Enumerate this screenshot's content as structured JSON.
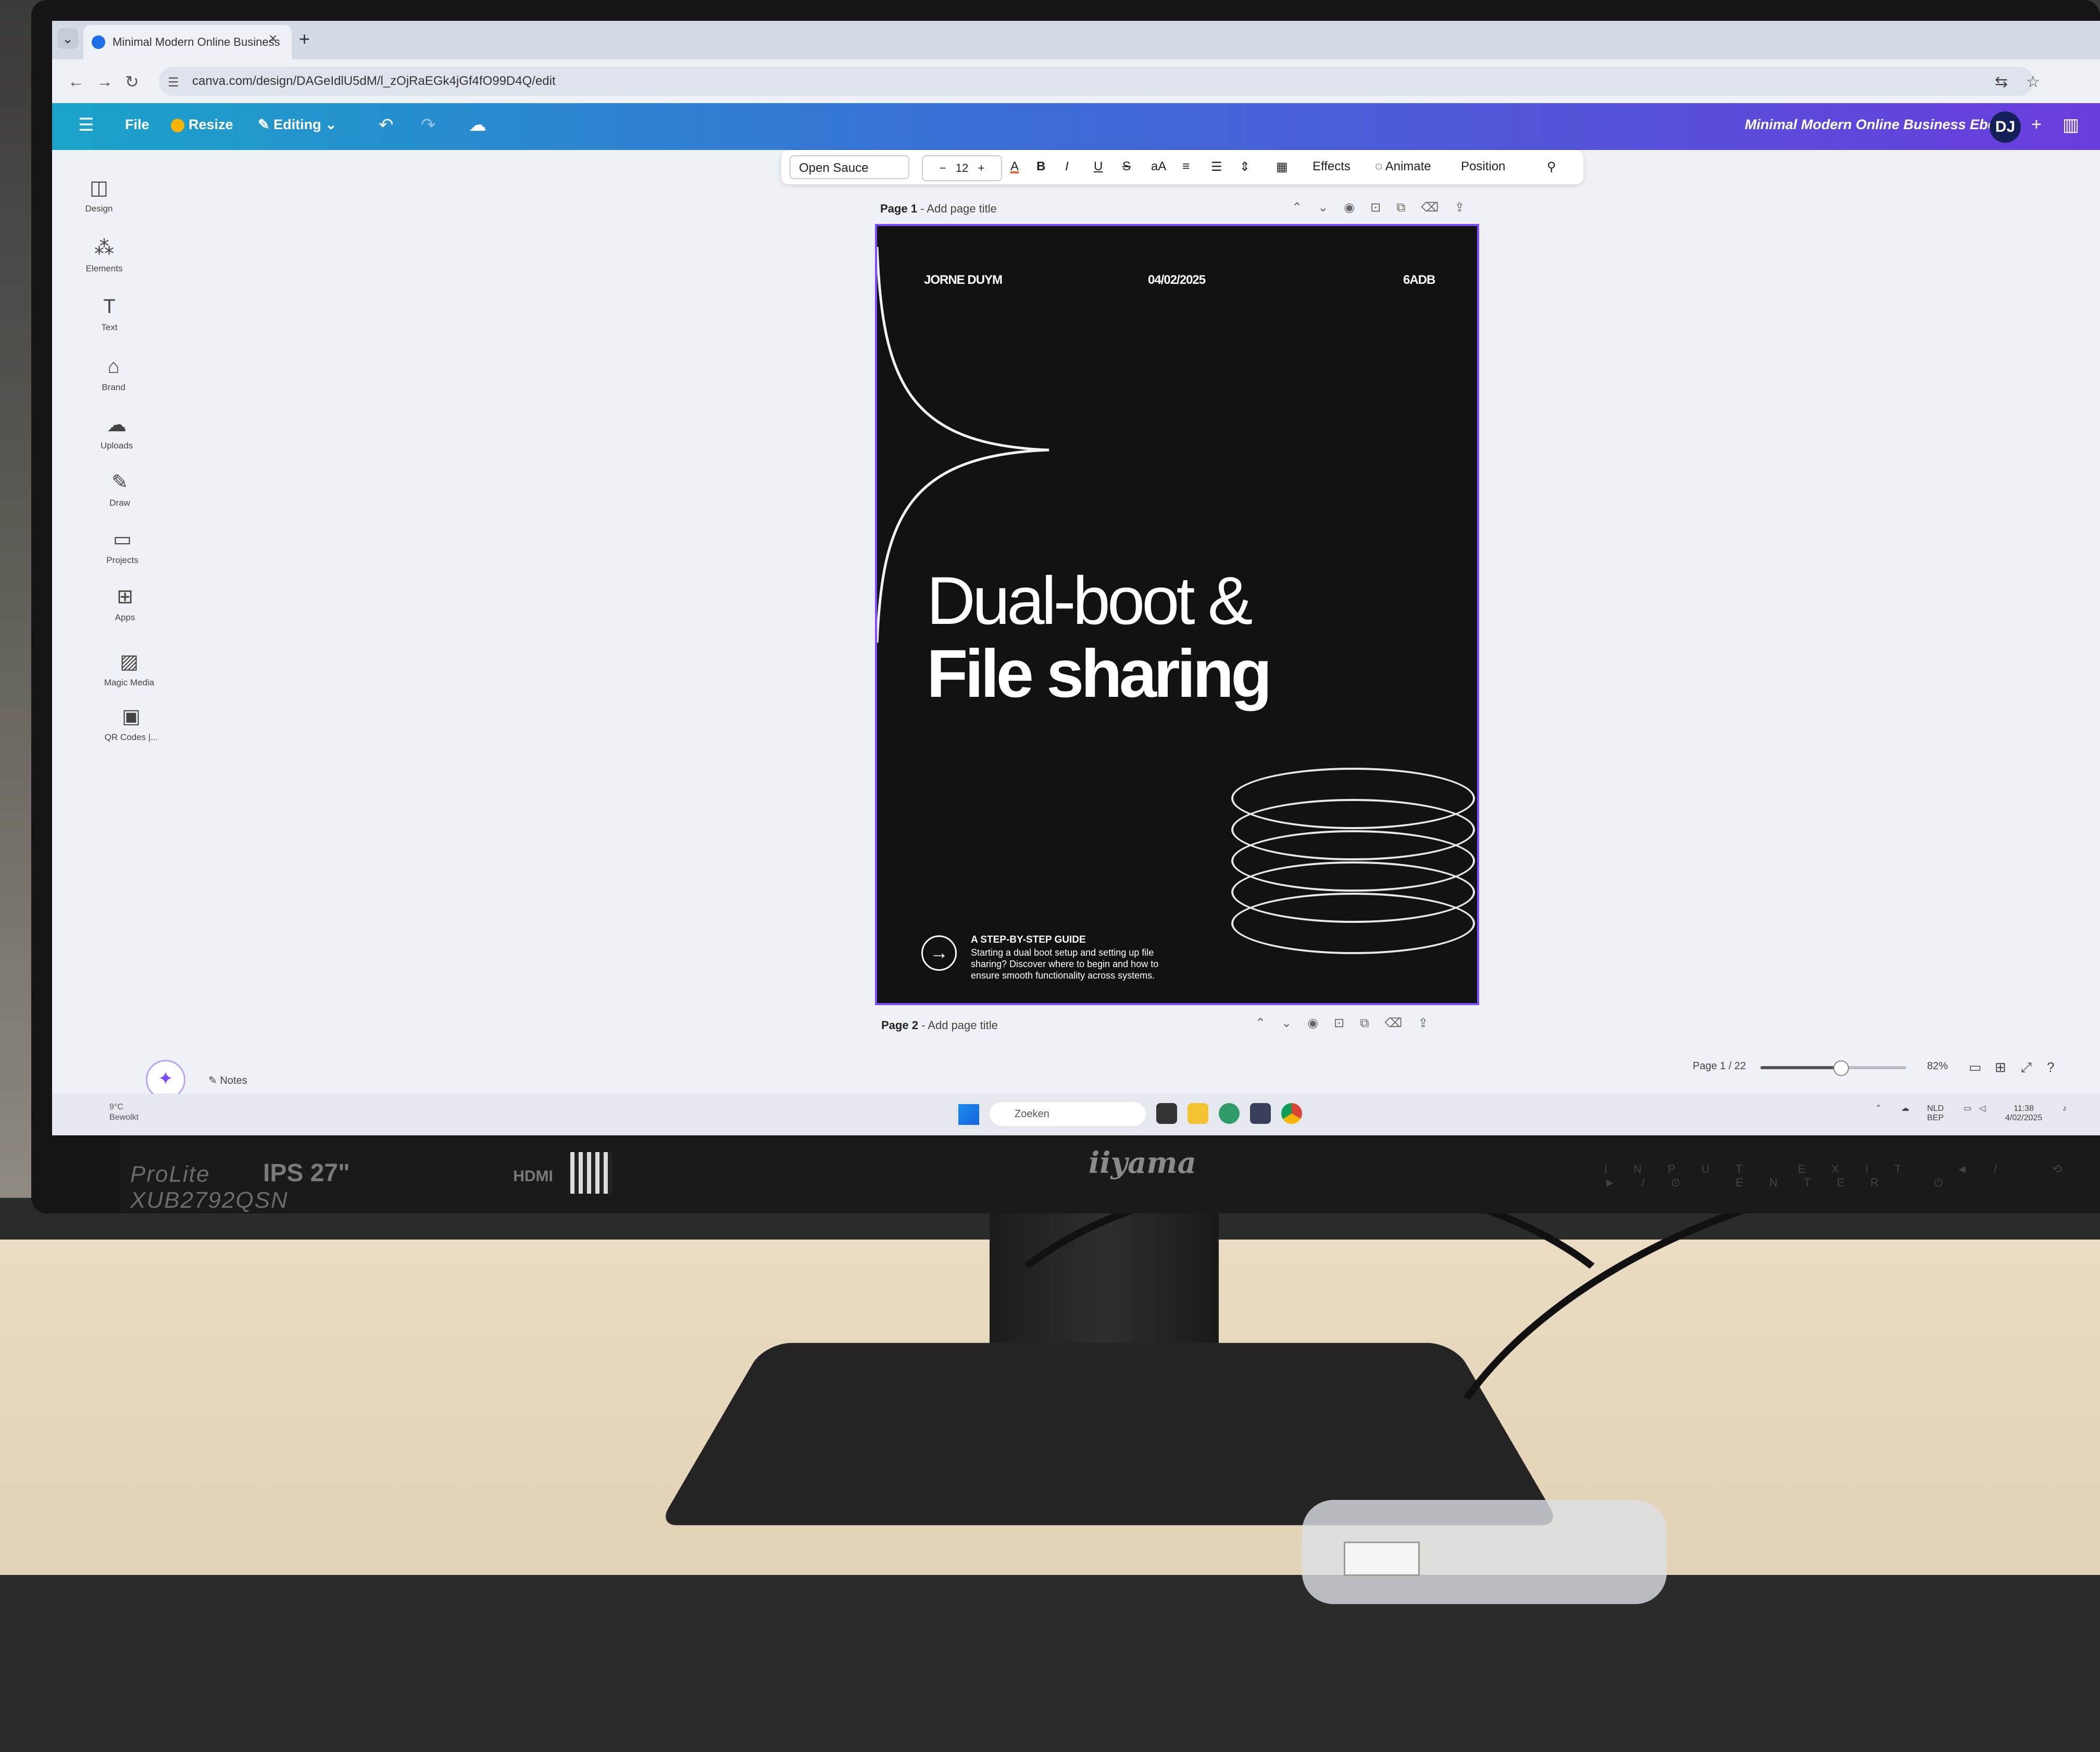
{
  "browser": {
    "tab_title": "Minimal Modern Online Business",
    "url": "canva.com/design/DAGeIdlU5dM/l_zOjRaEGk4jGf4fO99D4Q/edit"
  },
  "canva_header": {
    "menu_file": "File",
    "menu_resize": "Resize",
    "menu_editing": "Editing",
    "doc_title": "Minimal Modern Online Business Ebook",
    "avatar_initials": "DJ"
  },
  "sidebar": {
    "items": [
      {
        "label": "Design",
        "icon": "design-icon"
      },
      {
        "label": "Elements",
        "icon": "elements-icon"
      },
      {
        "label": "Text",
        "icon": "text-icon"
      },
      {
        "label": "Brand",
        "icon": "brand-icon"
      },
      {
        "label": "Uploads",
        "icon": "uploads-icon"
      },
      {
        "label": "Draw",
        "icon": "draw-icon"
      },
      {
        "label": "Projects",
        "icon": "projects-icon"
      },
      {
        "label": "Apps",
        "icon": "apps-icon"
      },
      {
        "label": "Magic Media",
        "icon": "magic-media-icon"
      },
      {
        "label": "QR Codes |...",
        "icon": "qr-code-icon"
      }
    ]
  },
  "toolbar": {
    "font": "Open Sauce",
    "size": "12",
    "effects": "Effects",
    "animate": "Animate",
    "position": "Position"
  },
  "pages": {
    "page1_label": "Page 1",
    "page1_title_placeholder": "- Add page title",
    "page2_label": "Page 2",
    "page2_title_placeholder": "- Add page title"
  },
  "ebook_cover": {
    "author": "JORNE DUYM",
    "date": "04/02/2025",
    "code": "6ADB",
    "title_line1": "Dual-boot &",
    "title_line2": "File sharing",
    "subtitle": "A STEP-BY-STEP GUIDE",
    "description": "Starting a dual boot setup and setting up file sharing? Discover where to begin and how to ensure smooth functionality across systems."
  },
  "footer": {
    "notes": "Notes",
    "page_indicator": "Page 1 / 22",
    "zoom": "82%",
    "zoom_fraction": 0.82
  },
  "taskbar": {
    "search_placeholder": "Zoeken",
    "weather_temp": "9°C",
    "weather_desc": "Bewolkt",
    "lang_top": "NLD",
    "lang_bottom": "BEP",
    "clock_time": "11:38",
    "clock_date": "4/02/2025"
  },
  "monitor": {
    "brand": "iiyama",
    "model_line1": "ProLite",
    "model_line2": "XUB2792QSN",
    "panel": "IPS",
    "size": "27\"",
    "hdmi": "HDMI",
    "buttons": [
      "INPUT",
      "EXIT",
      "◄/ ⟲",
      "►/⊙",
      "ENTER",
      "⏻"
    ]
  },
  "colors": {
    "canva_gradient_start": "#1aa3c9",
    "canva_gradient_end": "#6a3cdc",
    "selection_border": "#7c4dff",
    "cover_bg": "#121212"
  }
}
